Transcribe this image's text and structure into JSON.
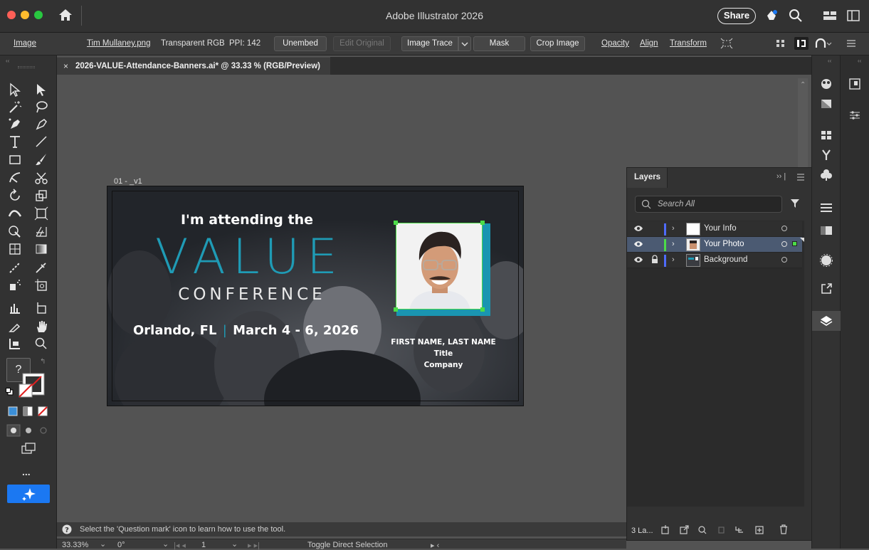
{
  "window": {
    "title": "Adobe Illustrator 2026",
    "share_label": "Share"
  },
  "control_bar": {
    "context_label": "Image",
    "file_name": "Tim Mullaney.png",
    "color_mode": "Transparent RGB",
    "ppi": "PPI: 142",
    "unembed": "Unembed",
    "edit_original": "Edit Original",
    "image_trace": "Image Trace",
    "mask": "Mask",
    "crop_image": "Crop Image",
    "opacity": "Opacity",
    "align": "Align",
    "transform": "Transform"
  },
  "document": {
    "tab_title": "2026-VALUE-Attendance-Banners.ai* @ 33.33 % (RGB/Preview)",
    "artboard_label": "01 - _v1"
  },
  "banner": {
    "attending": "I'm attending the",
    "value": "VALUE",
    "conference": "CONFERENCE",
    "location": "Orlando, FL",
    "separator": "|",
    "dates": "March 4 - 6, 2026",
    "name": "FIRST NAME, LAST NAME",
    "title": "Title",
    "company": "Company"
  },
  "layers_panel": {
    "title": "Layers",
    "search_placeholder": "Search All",
    "layers": [
      {
        "name": "Your Info",
        "color": "#4f6bff",
        "selected": false,
        "locked": false
      },
      {
        "name": "Your Photo",
        "color": "#4cdc48",
        "selected": true,
        "locked": false
      },
      {
        "name": "Background",
        "color": "#4f6bff",
        "selected": false,
        "locked": true
      }
    ],
    "footer_count": "3 La..."
  },
  "status": {
    "hint": "Select the 'Question mark' icon to learn how to use the tool.",
    "zoom": "33.33%",
    "rotation": "0°",
    "artboard_number": "1",
    "current_tool": "Toggle Direct Selection"
  },
  "toolbar": {
    "help_glyph": "?",
    "more_glyph": "..."
  },
  "colors": {
    "accent_teal": "#1f9bb5",
    "selection_green": "#4cdc48",
    "close_red": "#fe5f57",
    "minimize_yellow": "#febc2e",
    "zoom_green": "#28c840",
    "ai_blue": "#1b78f2"
  }
}
